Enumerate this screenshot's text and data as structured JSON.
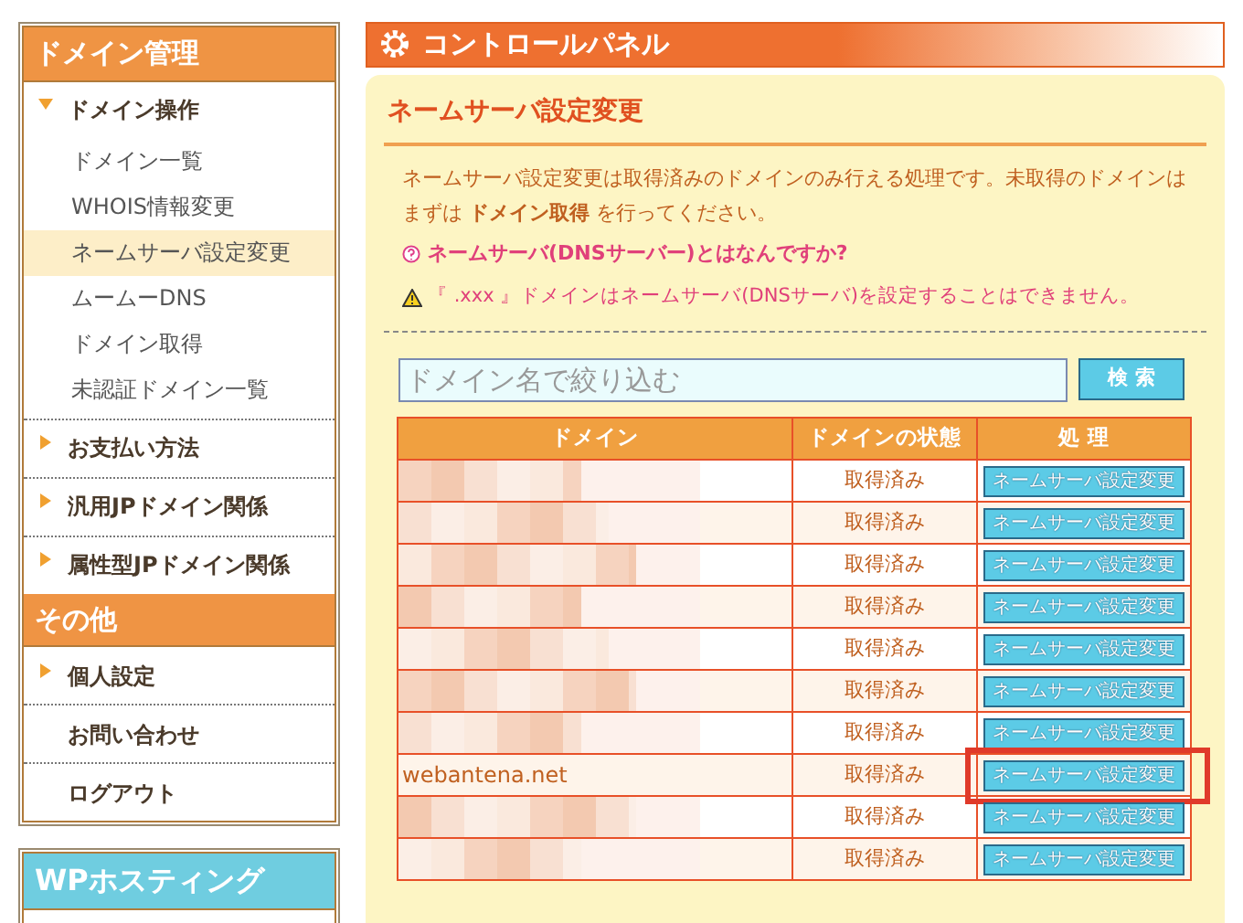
{
  "sidebar": {
    "sections": [
      {
        "title": "ドメイン管理",
        "items": [
          {
            "label": "ドメイン操作",
            "kind": "group",
            "expanded": true,
            "children": [
              {
                "label": "ドメイン一覧",
                "selected": false
              },
              {
                "label": "WHOIS情報変更",
                "selected": false
              },
              {
                "label": "ネームサーバ設定変更",
                "selected": true
              },
              {
                "label": "ムームーDNS",
                "selected": false
              },
              {
                "label": "ドメイン取得",
                "selected": false
              },
              {
                "label": "未認証ドメイン一覧",
                "selected": false
              }
            ]
          },
          {
            "label": "お支払い方法",
            "kind": "group",
            "expanded": false
          },
          {
            "label": "汎用JPドメイン関係",
            "kind": "group",
            "expanded": false
          },
          {
            "label": "属性型JPドメイン関係",
            "kind": "group",
            "expanded": false
          }
        ]
      },
      {
        "title": "その他",
        "items": [
          {
            "label": "個人設定",
            "kind": "group",
            "expanded": false
          },
          {
            "label": "お問い合わせ",
            "kind": "link"
          },
          {
            "label": "ログアウト",
            "kind": "link"
          }
        ]
      }
    ],
    "second_box": {
      "title": "WPホスティング"
    }
  },
  "header": {
    "title": "コントロールパネル"
  },
  "page": {
    "title": "ネームサーバ設定変更",
    "intro": "ネームサーバ設定変更は取得済みのドメインのみ行える処理です。未取得のドメインはまずは **ドメイン取得** を行ってください。",
    "help_link": "ネームサーバ(DNSサーバー)とはなんですか?",
    "warning": "『 .xxx 』ドメインはネームサーバ(DNSサーバ)を設定することはできません。",
    "search": {
      "placeholder": "ドメイン名で絞り込む",
      "button": "検 索"
    },
    "table": {
      "columns": [
        "ドメイン",
        "ドメインの状態",
        "処 理"
      ],
      "rows": [
        {
          "kind": "obscured",
          "status": "取得済み",
          "action": "ネームサーバ設定変更",
          "highlighted": false
        },
        {
          "kind": "obscured",
          "status": "取得済み",
          "action": "ネームサーバ設定変更",
          "highlighted": false
        },
        {
          "kind": "obscured",
          "status": "取得済み",
          "action": "ネームサーバ設定変更",
          "highlighted": false
        },
        {
          "kind": "obscured",
          "status": "取得済み",
          "action": "ネームサーバ設定変更",
          "highlighted": false
        },
        {
          "kind": "obscured",
          "status": "取得済み",
          "action": "ネームサーバ設定変更",
          "highlighted": false
        },
        {
          "kind": "obscured",
          "status": "取得済み",
          "action": "ネームサーバ設定変更",
          "highlighted": false
        },
        {
          "kind": "obscured",
          "status": "取得済み",
          "action": "ネームサーバ設定変更",
          "highlighted": false
        },
        {
          "kind": "text",
          "domain": "webantena.net",
          "status": "取得済み",
          "action": "ネームサーバ設定変更",
          "highlighted": true
        },
        {
          "kind": "obscured",
          "status": "取得済み",
          "action": "ネームサーバ設定変更",
          "highlighted": false
        },
        {
          "kind": "obscured",
          "status": "取得済み",
          "action": "ネームサーバ設定変更",
          "highlighted": false
        }
      ]
    }
  }
}
